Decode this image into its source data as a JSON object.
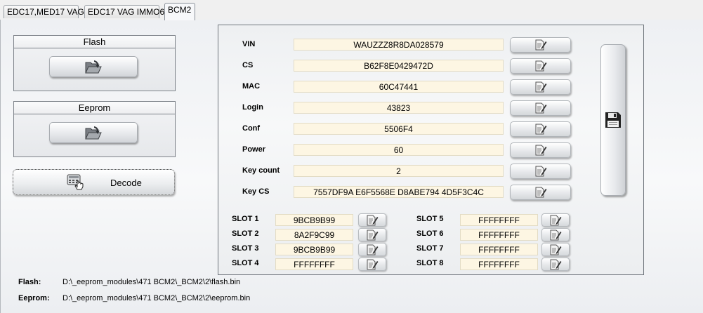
{
  "tabs": [
    "EDC17,MED17 VAG",
    "EDC17 VAG IMMO6",
    "BCM2"
  ],
  "left": {
    "flash_title": "Flash",
    "eeprom_title": "Eeprom",
    "decode_label": "Decode"
  },
  "fields": [
    {
      "label": "VIN",
      "value": "WAUZZZ8R8DA028579"
    },
    {
      "label": "CS",
      "value": "B62F8E0429472D"
    },
    {
      "label": "MAC",
      "value": "60C47441"
    },
    {
      "label": "Login",
      "value": "43823"
    },
    {
      "label": "Conf",
      "value": "5506F4"
    },
    {
      "label": "Power",
      "value": "60"
    },
    {
      "label": "Key count",
      "value": "2"
    },
    {
      "label": "Key CS",
      "value": "7557DF9A E6F5568E D8ABE794 4D5F3C4C"
    }
  ],
  "slots": [
    {
      "label": "SLOT 1",
      "value": "9BCB9B99"
    },
    {
      "label": "SLOT 2",
      "value": "8A2F9C99"
    },
    {
      "label": "SLOT 3",
      "value": "9BCB9B99"
    },
    {
      "label": "SLOT 4",
      "value": "FFFFFFFF"
    },
    {
      "label": "SLOT 5",
      "value": "FFFFFFFF"
    },
    {
      "label": "SLOT 6",
      "value": "FFFFFFFF"
    },
    {
      "label": "SLOT 7",
      "value": "FFFFFFFF"
    },
    {
      "label": "SLOT 8",
      "value": "FFFFFFFF"
    }
  ],
  "paths": {
    "flash_label": "Flash:",
    "flash_path": "D:\\_eeprom_modules\\471 BCM2\\_BCM2\\2\\flash.bin",
    "eeprom_label": "Eeprom:",
    "eeprom_path": "D:\\_eeprom_modules\\471 BCM2\\_BCM2\\2\\eeprom.bin"
  },
  "icons": {
    "open": "folder-open-icon",
    "edit": "edit-document-icon",
    "save": "floppy-disk-icon",
    "decode": "calculator-hand-icon"
  }
}
